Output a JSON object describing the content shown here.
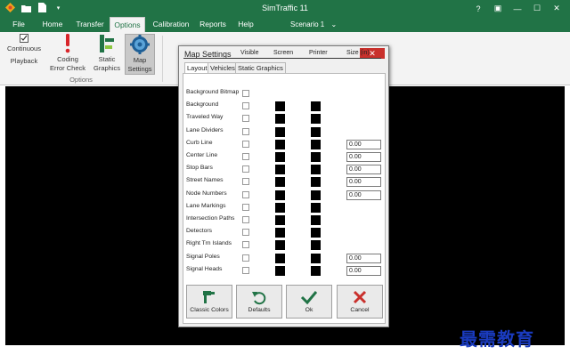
{
  "window": {
    "title": "SimTraffic 11",
    "controls": {
      "help": "?",
      "restore_box": "▣",
      "minimize": "—",
      "maximize": "☐",
      "close": "✕"
    }
  },
  "menu": {
    "tabs": [
      {
        "label": "File"
      },
      {
        "label": "Home"
      },
      {
        "label": "Transfer"
      },
      {
        "label": "Options",
        "active": true
      },
      {
        "label": "Calibration"
      },
      {
        "label": "Reports"
      },
      {
        "label": "Help"
      }
    ],
    "scenario": "Scenario 1"
  },
  "ribbon": {
    "buttons": [
      {
        "line1": "Continuous",
        "line2": "Playback",
        "icon": "checkbox-icon"
      },
      {
        "line1": "Coding",
        "line2": "Error Check",
        "icon": "exclamation-icon"
      },
      {
        "line1": "Static",
        "line2": "Graphics",
        "icon": "bars-icon"
      },
      {
        "line1": "Map",
        "line2": "Settings",
        "icon": "map-settings-icon",
        "selected": true
      }
    ],
    "group_label": "Options"
  },
  "dialog": {
    "title": "Map Settings",
    "close": "✕",
    "tabs": [
      "Layout",
      "Vehicles",
      "Static Graphics"
    ],
    "columns": {
      "visible": "Visible",
      "screen": "Screen",
      "printer": "Printer",
      "size": "Size (in)"
    },
    "rows": [
      {
        "label": "Background Bitmap",
        "swatch": false,
        "size": null
      },
      {
        "label": "Background",
        "swatch": true,
        "size": null
      },
      {
        "label": "Traveled Way",
        "swatch": true,
        "size": null
      },
      {
        "label": "Lane Dividers",
        "swatch": true,
        "size": null
      },
      {
        "label": "Curb Line",
        "swatch": true,
        "size": "0.00"
      },
      {
        "label": "Center Line",
        "swatch": true,
        "size": "0.00"
      },
      {
        "label": "Stop Bars",
        "swatch": true,
        "size": "0.00"
      },
      {
        "label": "Street Names",
        "swatch": true,
        "size": "0.00"
      },
      {
        "label": "Node Numbers",
        "swatch": true,
        "size": "0.00"
      },
      {
        "label": "Lane Markings",
        "swatch": true,
        "size": null
      },
      {
        "label": "Intersection Paths",
        "swatch": true,
        "size": null
      },
      {
        "label": "Detectors",
        "swatch": true,
        "size": null
      },
      {
        "label": "Right Trn Islands",
        "swatch": true,
        "size": null
      },
      {
        "label": "Signal Poles",
        "swatch": true,
        "size": "0.00"
      },
      {
        "label": "Signal Heads",
        "swatch": true,
        "size": "0.00"
      }
    ],
    "buttons": {
      "classic_colors": "Classic Colors",
      "defaults": "Defaults",
      "ok": "Ok",
      "cancel": "Cancel"
    }
  },
  "watermark": "最需教育",
  "colors": {
    "accent": "#217346",
    "cancel": "#c9302c",
    "ok": "#217346"
  }
}
